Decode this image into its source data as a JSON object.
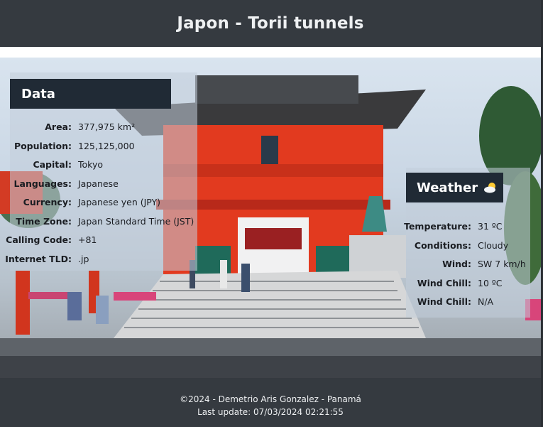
{
  "header": {
    "title": "Japon - Torii tunnels"
  },
  "data_panel": {
    "title": "Data",
    "rows": [
      {
        "label": "Area:",
        "value": "377,975 km²"
      },
      {
        "label": "Population:",
        "value": "125,125,000"
      },
      {
        "label": "Capital:",
        "value": "Tokyo"
      },
      {
        "label": "Languages:",
        "value": "Japanese"
      },
      {
        "label": "Currency:",
        "value": "Japanese yen (JPY)"
      },
      {
        "label": "Time Zone:",
        "value": "Japan Standard Time (JST)"
      },
      {
        "label": "Calling Code:",
        "value": "+81"
      },
      {
        "label": "Internet TLD:",
        "value": ".jp"
      }
    ]
  },
  "weather_panel": {
    "title": "Weather",
    "icon": "partly-cloudy-icon",
    "rows": [
      {
        "label": "Temperature:",
        "value": "31 ºC"
      },
      {
        "label": "Conditions:",
        "value": "Cloudy"
      },
      {
        "label": "Wind:",
        "value": "SW 7 km/h"
      },
      {
        "label": "Wind Chill:",
        "value": "10 ºC"
      },
      {
        "label": "Wind Chill:",
        "value": "N/A"
      }
    ]
  },
  "footer": {
    "line1": "©2024 - Demetrio Aris Gonzalez - Panamá",
    "line2": "Last update: 07/03/2024 02:21:55"
  },
  "colors": {
    "header_bg": "#353a40",
    "panel_title_bg": "#202a35",
    "gate_red": "#e23a1f"
  }
}
